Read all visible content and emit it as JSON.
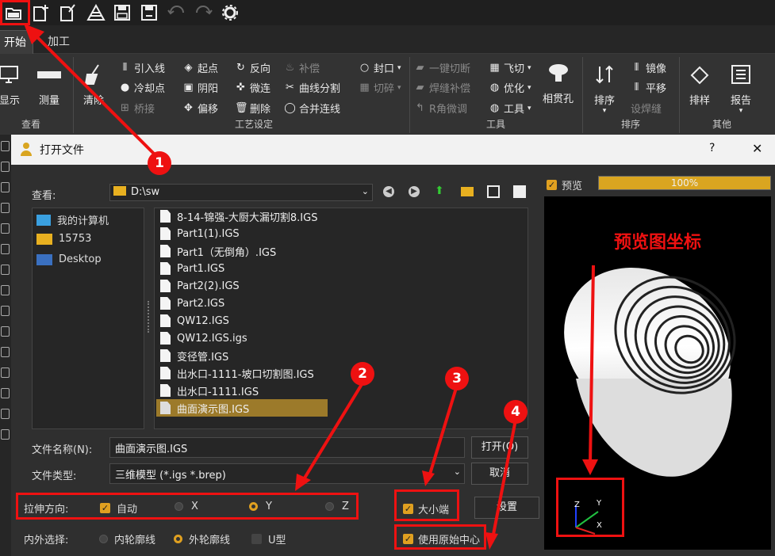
{
  "quick_toolbar": {
    "icons": [
      "open-file-icon",
      "new-file-icon",
      "edit-file-icon",
      "import-icon",
      "save-icon",
      "save-as-icon",
      "undo-icon",
      "redo-icon",
      "settings-icon"
    ]
  },
  "tabs": [
    {
      "label": "开始"
    },
    {
      "label": "加工"
    }
  ],
  "ribbon": {
    "display": "显示",
    "measure": "测量",
    "clear": "清除",
    "lead_line": "引入线",
    "start_point": "起点",
    "reverse": "反向",
    "compensate": "补偿",
    "close": "封口",
    "cooling_point": "冷却点",
    "yin_yang": "阴阳",
    "micro_link": "微连",
    "curve_split": "曲线分割",
    "bridge": "桥接",
    "offset": "偏移",
    "delete": "删除",
    "merge": "合并连线",
    "one_key_cut": "一键切断",
    "weld_compensate": "焊缝补偿",
    "r_angle": "R角微调",
    "fly_cut": "飞切",
    "optimize": "优化",
    "tools": "工具",
    "cut_break": "切碎",
    "through_hole": "相贯孔",
    "sort": "排序",
    "mirror": "镜像",
    "translate": "平移",
    "set_weld": "设焊缝",
    "sample": "排样",
    "report": "报告",
    "groups": [
      "查看",
      "工艺设定",
      "工具",
      "排序",
      "其他"
    ]
  },
  "dialog": {
    "title": "打开文件",
    "help": "?",
    "close": "✕",
    "look_in_label": "查看:",
    "look_in_value": "D:\\sw",
    "places": [
      {
        "label": "我的计算机",
        "icon": "computer-icon"
      },
      {
        "label": "15753",
        "icon": "folder-icon"
      },
      {
        "label": "Desktop",
        "icon": "desktop-icon"
      }
    ],
    "files": [
      "8-14-锦强-大厨大漏切割8.IGS",
      "Part1(1).IGS",
      "Part1（无倒角）.IGS",
      "Part1.IGS",
      "Part2(2).IGS",
      "Part2.IGS",
      "QW12.IGS",
      "QW12.IGS.igs",
      "变径管.IGS",
      "出水口-1111-坡口切割图.IGS",
      "出水口-1111.IGS",
      "曲面演示图.IGS"
    ],
    "selected_file": "曲面演示图.IGS",
    "filename_label": "文件名称(N):",
    "filename_value": "曲面演示图.IGS",
    "filetype_label": "文件类型:",
    "filetype_value": "三维模型 (*.igs *.brep)",
    "open_button": "打开(O)",
    "cancel_button": "取消",
    "stretch_label": "拉伸方向:",
    "auto_label": "自动",
    "x_label": "X",
    "y_label": "Y",
    "z_label": "Z",
    "big_small_label": "大小端",
    "settings_button": "设置",
    "inout_label": "内外选择:",
    "inner_label": "内轮廓线",
    "outer_label": "外轮廓线",
    "u_label": "U型",
    "use_origin_label": "使用原始中心",
    "preview_label": "预览",
    "progress": "100%",
    "progress_fraction": 1.0,
    "preview_annotation": "预览图坐标",
    "axis_x": "X",
    "axis_y": "Y",
    "axis_z": "Z"
  },
  "annotations": [
    "1",
    "2",
    "3",
    "4"
  ],
  "colors": {
    "accent": "#e0a020",
    "annotation": "#e11111",
    "selection": "#9c7a2a"
  }
}
